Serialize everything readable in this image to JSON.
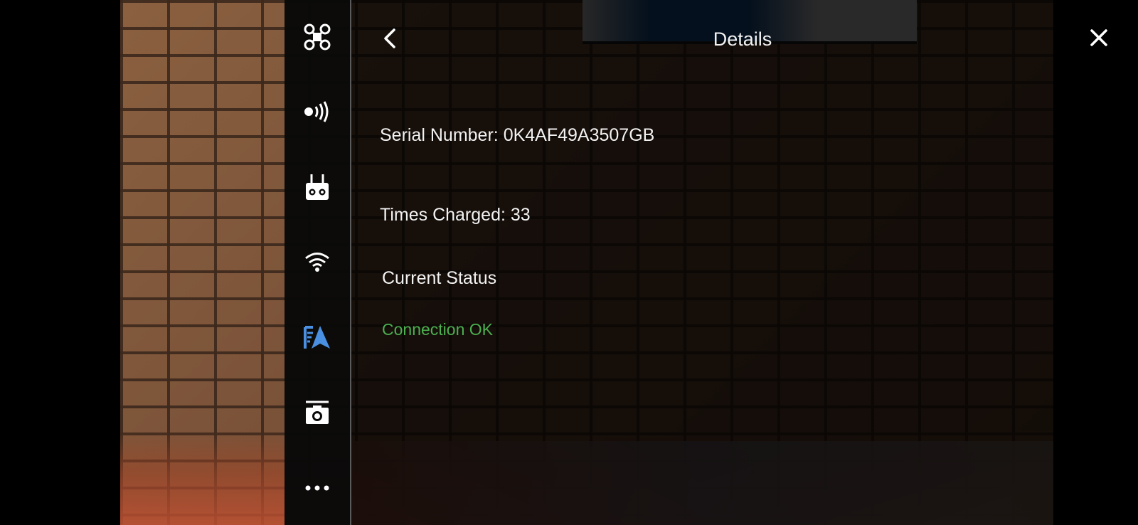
{
  "header": {
    "title": "Details"
  },
  "battery": {
    "serial_label": "Serial Number:",
    "serial_value": "0K4AF49A3507GB",
    "charged_label": "Times Charged:",
    "charged_value": "33"
  },
  "status": {
    "heading": "Current Status",
    "value": "Connection OK",
    "ok_color": "#4caf50"
  },
  "sidebar": {
    "items": [
      {
        "icon": "drone-icon",
        "active": false
      },
      {
        "icon": "signal-broadcast-icon",
        "active": false
      },
      {
        "icon": "remote-controller-icon",
        "active": false
      },
      {
        "icon": "wifi-icon",
        "active": false
      },
      {
        "icon": "battery-flight-icon",
        "active": true
      },
      {
        "icon": "camera-icon",
        "active": false
      },
      {
        "icon": "more-dots-icon",
        "active": false
      }
    ],
    "active_color": "#4a90e2"
  }
}
